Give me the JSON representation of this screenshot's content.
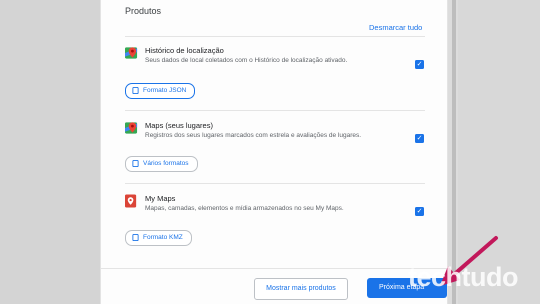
{
  "page": {
    "section_title": "Produtos",
    "deselect_all": "Desmarcar tudo"
  },
  "products": [
    {
      "name": "Histórico de localização",
      "description": "Seus dados de local coletados com o Histórico de localização ativado.",
      "format": "Formato JSON",
      "checked": true,
      "icon": "maps-pin-icon"
    },
    {
      "name": "Maps (seus lugares)",
      "description": "Registros dos seus lugares marcados com estrela e avaliações de lugares.",
      "format": "Vários formatos",
      "checked": true,
      "icon": "maps-pin-icon"
    },
    {
      "name": "My Maps",
      "description": "Mapas, camadas, elementos e mídia armazenados no seu My Maps.",
      "format": "Formato KMZ",
      "checked": true,
      "icon": "my-maps-icon"
    }
  ],
  "footer": {
    "more_products": "Mostrar mais produtos",
    "next_step": "Próxima etapa"
  },
  "watermark": "techtudo",
  "colors": {
    "accent": "#1a73e8",
    "arrow": "#c2185b"
  }
}
